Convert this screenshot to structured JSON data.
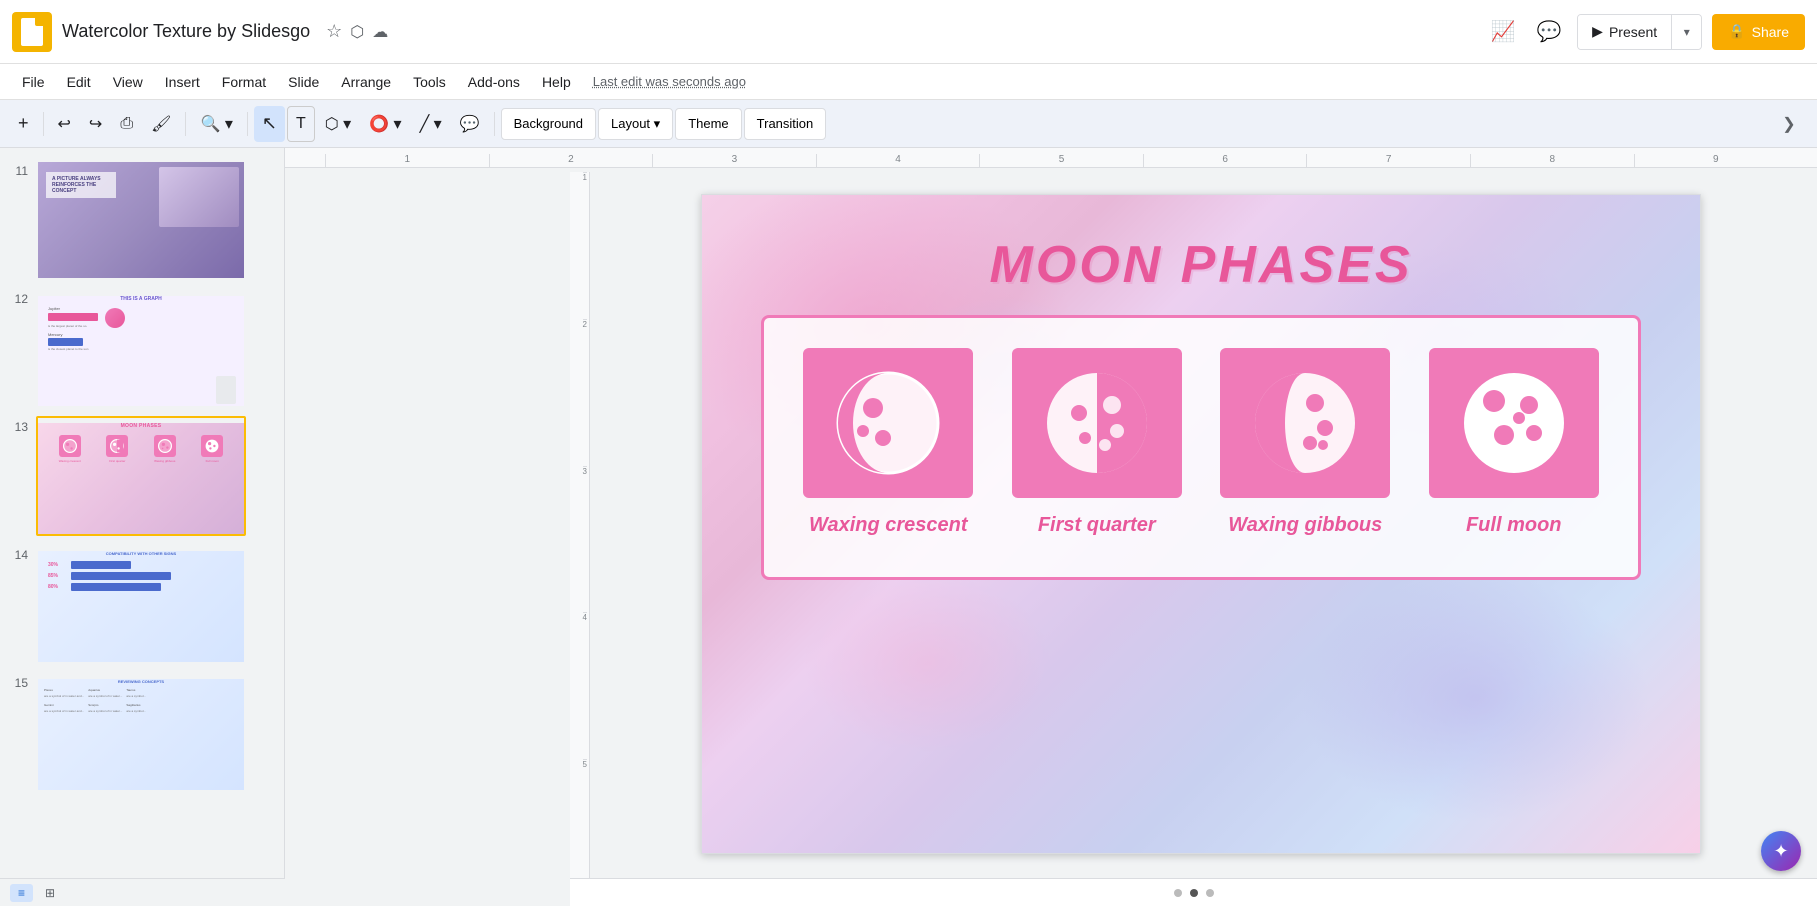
{
  "app": {
    "logo_alt": "Google Slides logo"
  },
  "header": {
    "title": "Watercolor Texture by Slidesgo",
    "star_icon": "★",
    "folder_icon": "📁",
    "cloud_icon": "☁",
    "last_edit": "Last edit was seconds ago"
  },
  "top_right": {
    "trending_icon": "📈",
    "comment_icon": "💬",
    "present_icon": "▶",
    "present_label": "Present",
    "share_icon": "🔒",
    "share_label": "Share"
  },
  "menu": {
    "items": [
      "File",
      "Edit",
      "View",
      "Insert",
      "Format",
      "Slide",
      "Arrange",
      "Tools",
      "Add-ons",
      "Help"
    ]
  },
  "toolbar": {
    "add_slide": "+",
    "undo": "↩",
    "redo": "↪",
    "print": "🖨",
    "paint_format": "🖌",
    "zoom": "🔍",
    "select": "↖",
    "text": "T",
    "image": "🖼",
    "shapes": "⬡",
    "line": "╱",
    "background_label": "Background",
    "layout_label": "Layout",
    "layout_arrow": "▾",
    "theme_label": "Theme",
    "transition_label": "Transition"
  },
  "slides": [
    {
      "num": "11",
      "type": "picture-reinforces"
    },
    {
      "num": "12",
      "type": "graph"
    },
    {
      "num": "13",
      "type": "moon-phases",
      "active": true
    },
    {
      "num": "14",
      "type": "compatibility"
    },
    {
      "num": "15",
      "type": "reviewing-concepts"
    }
  ],
  "main_slide": {
    "title": "MOON PHASES",
    "moons": [
      {
        "name": "Waxing crescent",
        "icon_type": "waxing-crescent"
      },
      {
        "name": "First quarter",
        "icon_type": "first-quarter"
      },
      {
        "name": "Waxing gibbous",
        "icon_type": "waxing-gibbous"
      },
      {
        "name": "Full moon",
        "icon_type": "full-moon"
      }
    ]
  },
  "ruler": {
    "h_marks": [
      "1",
      "2",
      "3",
      "4",
      "5",
      "6",
      "7",
      "8",
      "9"
    ],
    "v_marks": [
      "1",
      "2",
      "3",
      "4",
      "5"
    ]
  },
  "bottom_dots": [
    "",
    "",
    ""
  ],
  "view_buttons": [
    {
      "label": "≡",
      "active": true
    },
    {
      "label": "⊞",
      "active": false
    }
  ],
  "colors": {
    "pink_primary": "#e8579a",
    "pink_box": "#f07ab8",
    "title_color": "#e8579a",
    "active_border": "#fbbc04"
  }
}
